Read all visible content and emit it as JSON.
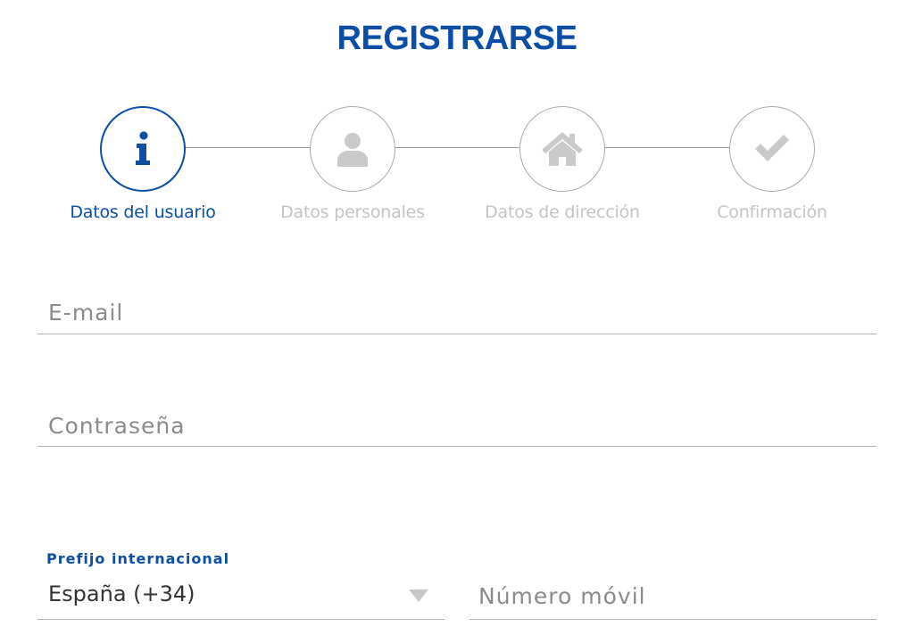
{
  "page": {
    "title": "REGISTRARSE"
  },
  "stepper": {
    "active_color": "#0a4ea6",
    "inactive_color": "#c4c4c4",
    "steps": [
      {
        "label": "Datos del usuario",
        "icon": "info-icon",
        "active": true
      },
      {
        "label": "Datos personales",
        "icon": "user-icon",
        "active": false
      },
      {
        "label": "Datos de dirección",
        "icon": "home-icon",
        "active": false
      },
      {
        "label": "Confirmación",
        "icon": "checkmark-icon",
        "active": false
      }
    ]
  },
  "form": {
    "email": {
      "placeholder": "E-mail"
    },
    "password": {
      "placeholder": "Contraseña"
    },
    "phone_prefix": {
      "label": "Prefijo internacional",
      "value": "España (+34)",
      "icon": "dropdown-arrow-icon"
    },
    "mobile": {
      "placeholder": "Número móvil"
    }
  }
}
